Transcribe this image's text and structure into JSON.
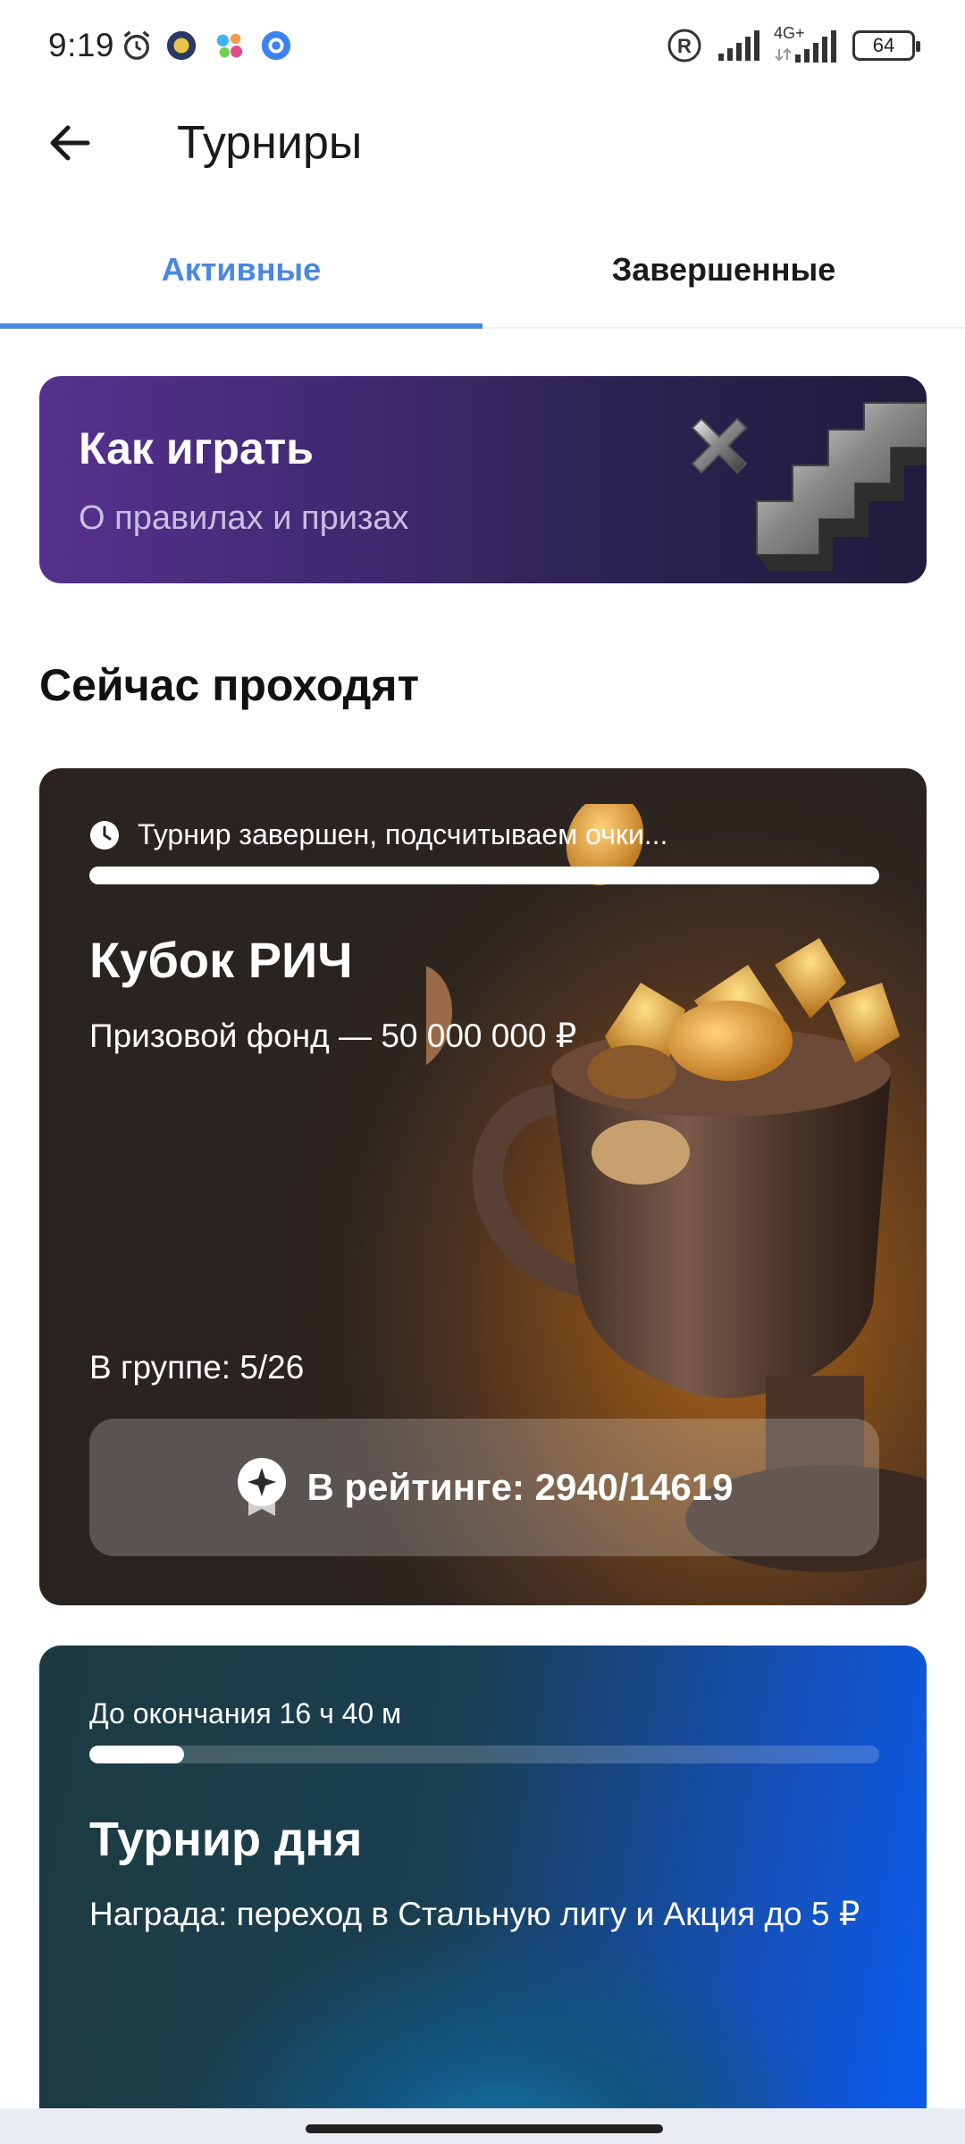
{
  "status_bar": {
    "time": "9:19",
    "battery": "64",
    "network": "4G+"
  },
  "header": {
    "title": "Турниры",
    "back_icon": "arrow-left-icon"
  },
  "tabs": [
    {
      "label": "Активные",
      "active": true
    },
    {
      "label": "Завершенные",
      "active": false
    }
  ],
  "howto_banner": {
    "title": "Как играть",
    "subtitle": "О правилах и призах"
  },
  "section": {
    "title": "Сейчас проходят"
  },
  "tournament_1": {
    "status": "Турнир завершен, подсчитываем очки...",
    "progress": 1.0,
    "title": "Кубок РИЧ",
    "prize": "Призовой фонд — 50 000 000 ₽",
    "group": "В группе: 5/26",
    "rating": "В рейтинге: 2940/14619"
  },
  "tournament_2": {
    "time_left": "До окончания 16 ч 40 м",
    "progress": 0.12,
    "title": "Турнир дня",
    "reward": "Награда: переход в Стальную лигу и Акция до 5 ₽"
  },
  "colors": {
    "accent": "#4a88e0",
    "howto_bg": "#3e2a6e",
    "card2_accent": "#0a5cf0"
  }
}
